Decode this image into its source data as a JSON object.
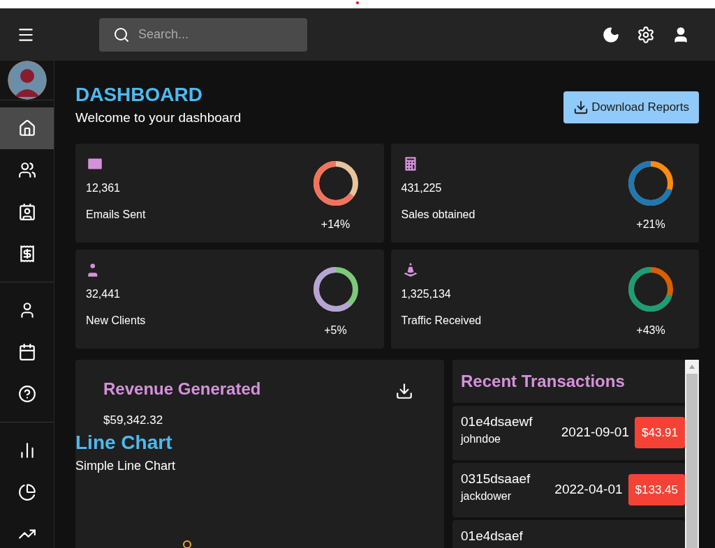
{
  "topbar": {
    "search": {
      "placeholder": "Search..."
    }
  },
  "sidebar": {
    "groups": [
      [
        {
          "kind": "home",
          "selected": true
        },
        {
          "kind": "team",
          "selected": false
        },
        {
          "kind": "contacts",
          "selected": false
        },
        {
          "kind": "invoices",
          "selected": false
        }
      ],
      [
        {
          "kind": "profile",
          "selected": false
        },
        {
          "kind": "calendar",
          "selected": false
        },
        {
          "kind": "faq",
          "selected": false
        }
      ],
      [
        {
          "kind": "bar",
          "selected": false
        },
        {
          "kind": "pie",
          "selected": false
        },
        {
          "kind": "line",
          "selected": false
        }
      ]
    ]
  },
  "header": {
    "title": "DASHBOARD",
    "subtitle": "Welcome to your dashboard",
    "download_button": "Download Reports"
  },
  "stats": [
    {
      "kind": "mail",
      "value": "12,361",
      "label": "Emails Sent",
      "change": "+14%"
    },
    {
      "kind": "sales",
      "value": "431,225",
      "label": "Sales obtained",
      "change": "+21%"
    },
    {
      "kind": "client",
      "value": "32,441",
      "label": "New Clients",
      "change": "+5%"
    },
    {
      "kind": "traffic",
      "value": "1,325,134",
      "label": "Traffic Received",
      "change": "+43%"
    }
  ],
  "revenue": {
    "title": "Revenue Generated",
    "amount": "$59,342.32",
    "chart_title": "Line Chart",
    "chart_subtitle": "Simple Line Chart"
  },
  "transactions": {
    "title": "Recent Transactions",
    "rows": [
      {
        "id": "01e4dsaewf",
        "user": "johndoe",
        "date": "2021-09-01",
        "amount": "$43.91"
      },
      {
        "id": "0315dsaaef",
        "user": "jackdower",
        "date": "2022-04-01",
        "amount": "$133.45"
      },
      {
        "id": "01e4dsaef"
      }
    ]
  }
}
